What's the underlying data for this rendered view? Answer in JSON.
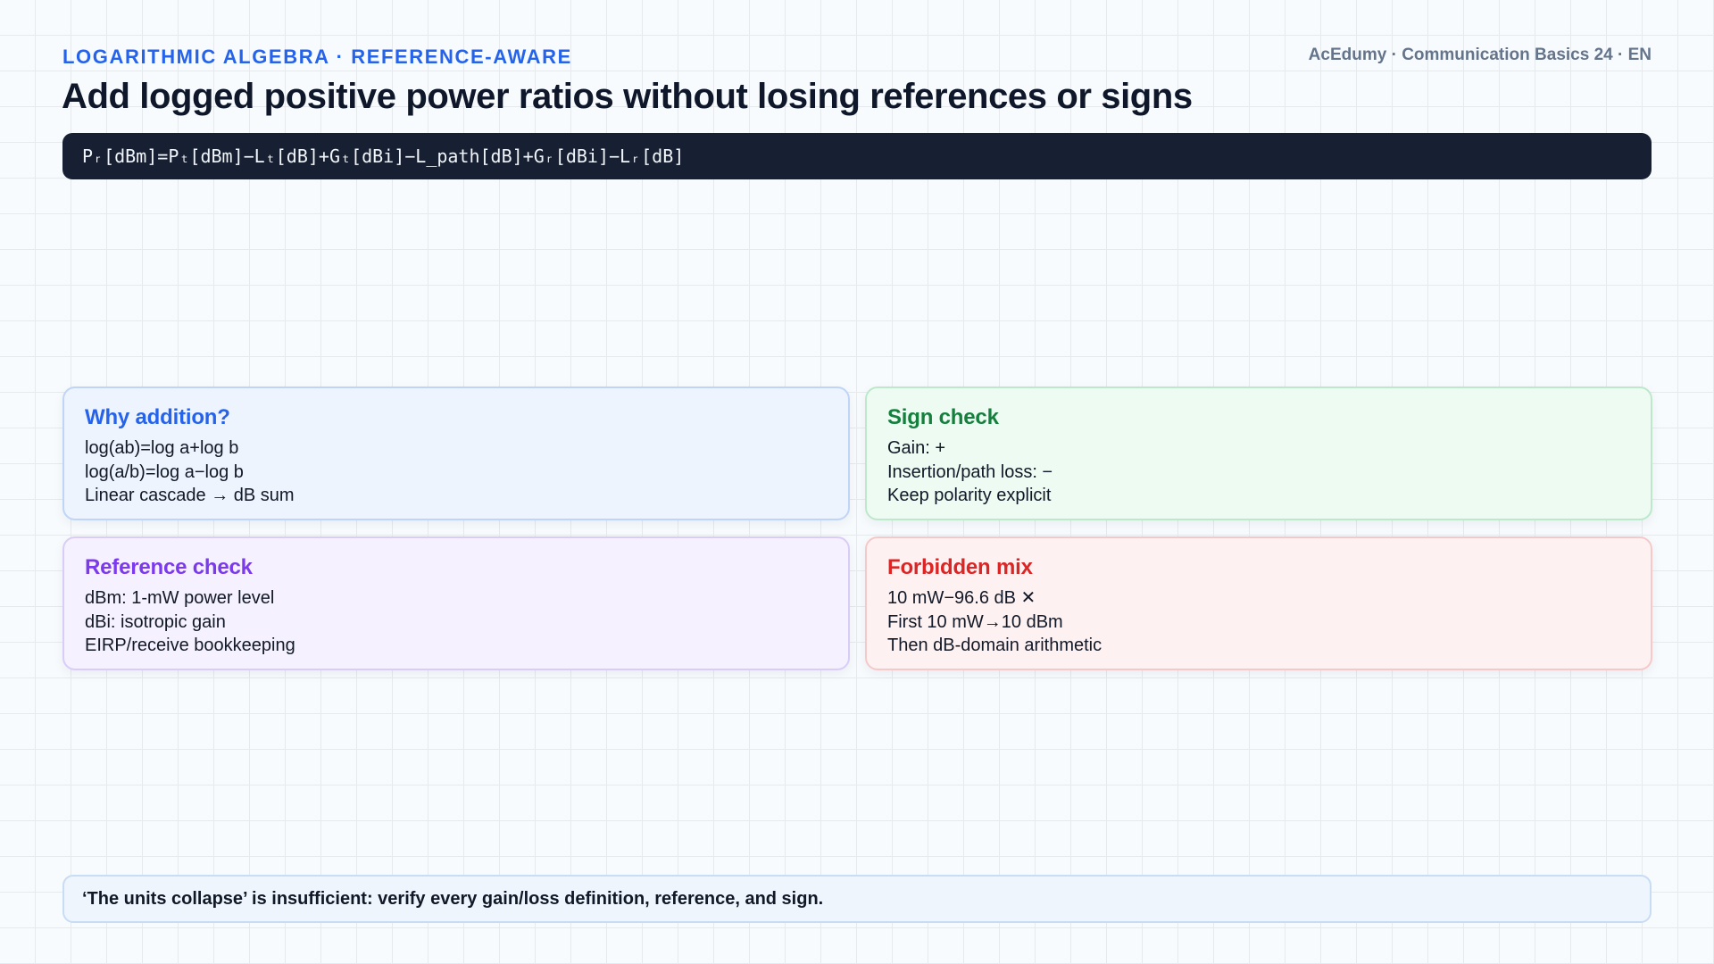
{
  "header": {
    "kicker": "LOGARITHMIC ALGEBRA · REFERENCE-AWARE",
    "meta": "AcEdumy · Communication Basics 24 · EN",
    "title": "Add logged positive power ratios without losing references or signs"
  },
  "formula": "Pᵣ[dBm]=Pₜ[dBm]−Lₜ[dB]+Gₜ[dBi]−L_path[dB]+Gᵣ[dBi]−Lᵣ[dB]",
  "cards": [
    {
      "title": "Why addition?",
      "lines": [
        "log(ab)=log a+log b",
        "log(a/b)=log a−log b",
        "Linear cascade → dB sum"
      ],
      "accent": "#2563eb"
    },
    {
      "title": "Sign check",
      "lines": [
        "Gain: +",
        "Insertion/path loss: −",
        "Keep polarity explicit"
      ],
      "accent": "#15803d"
    },
    {
      "title": "Reference check",
      "lines": [
        "dBm: 1-mW power level",
        "dBi: isotropic gain",
        "EIRP/receive bookkeeping"
      ],
      "accent": "#7c3aed"
    },
    {
      "title": "Forbidden mix",
      "lines": [
        "10 mW−96.6 dB ✕",
        "First 10 mW→10 dBm",
        "Then dB-domain arithmetic"
      ],
      "accent": "#dc2626"
    }
  ],
  "footer": {
    "note": "‘The units collapse’ is insufficient: verify every gain/loss definition, reference, and sign."
  }
}
